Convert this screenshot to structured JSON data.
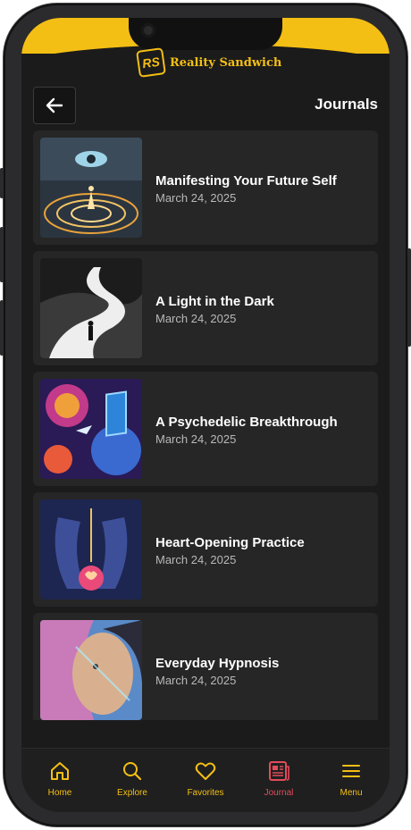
{
  "app": {
    "brand": "Reality Sandwich",
    "brand_mark": "RS"
  },
  "header": {
    "title": "Journals"
  },
  "journals": [
    {
      "title": "Manifesting Your Future Self",
      "date": "March 24, 2025"
    },
    {
      "title": "A Light in the Dark",
      "date": "March 24, 2025"
    },
    {
      "title": " A Psychedelic Breakthrough",
      "date": "March 24, 2025"
    },
    {
      "title": "Heart-Opening Practice",
      "date": "March 24, 2025"
    },
    {
      "title": "Everyday Hypnosis",
      "date": "March 24, 2025"
    }
  ],
  "nav": {
    "items": [
      {
        "label": "Home",
        "icon": "home-icon"
      },
      {
        "label": "Explore",
        "icon": "search-icon"
      },
      {
        "label": "Favorites",
        "icon": "heart-icon"
      },
      {
        "label": "Journal",
        "icon": "newspaper-icon",
        "active": true
      },
      {
        "label": "Menu",
        "icon": "menu-icon"
      }
    ]
  },
  "colors": {
    "accent": "#f4bf14",
    "active": "#e34b5a",
    "background": "#1b1b1b",
    "card": "#262626"
  }
}
